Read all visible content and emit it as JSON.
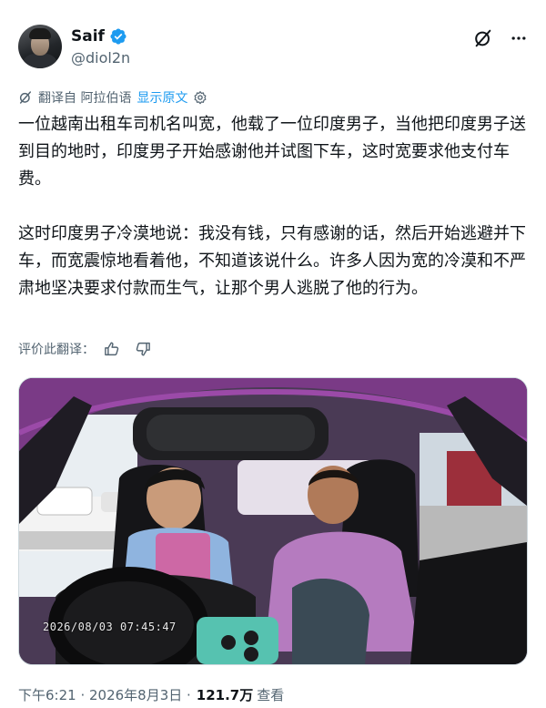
{
  "author": {
    "display_name": "Saif",
    "handle": "@diol2n",
    "verified": true
  },
  "header_icons": [
    "grok-icon",
    "more-icon"
  ],
  "translation": {
    "translated_from": "翻译自 阿拉伯语",
    "show_original": "显示原文"
  },
  "tweet": {
    "paragraphs": [
      "一位越南出租车司机名叫宽，他载了一位印度男子，当他把印度男子送到目的地时，印度男子开始感谢他并试图下车，这时宽要求他支付车费。",
      "这时印度男子冷漠地说：我没有钱，只有感谢的话，然后开始逃避并下车，而宽震惊地看着他，不知道该说什么。许多人因为宽的冷漠和不严肃地坚决要求付款而生气，让那个男人逃脱了他的行为。"
    ]
  },
  "rate_translation": {
    "label": "评价此翻译："
  },
  "media": {
    "overlay_timestamp": "2026/08/03 07:45:47"
  },
  "meta": {
    "time": "下午6:21 · 2026年8月3日 · ",
    "views": "121.7万",
    "views_label": "查看"
  },
  "colors": {
    "accent": "#1d9bf0",
    "secondary_text": "#536471",
    "primary_text": "#0f1419"
  }
}
